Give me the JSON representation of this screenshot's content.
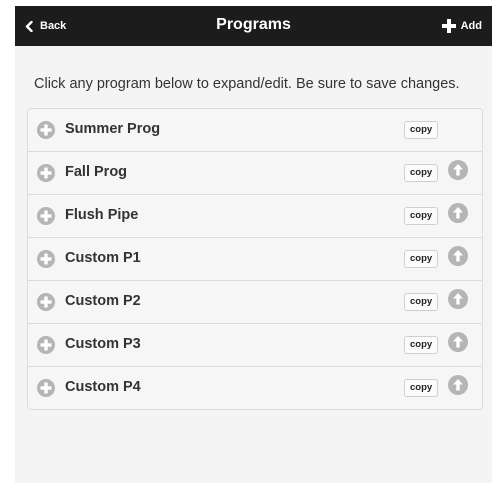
{
  "header": {
    "back_label": "Back",
    "title": "Programs",
    "add_label": "Add"
  },
  "instructions": "Click any program below to expand/edit. Be sure to save changes.",
  "programs": [
    {
      "name": "Summer Prog",
      "copy_label": "copy",
      "has_move_up": false
    },
    {
      "name": "Fall Prog",
      "copy_label": "copy",
      "has_move_up": true
    },
    {
      "name": "Flush Pipe",
      "copy_label": "copy",
      "has_move_up": true
    },
    {
      "name": "Custom P1",
      "copy_label": "copy",
      "has_move_up": true
    },
    {
      "name": "Custom P2",
      "copy_label": "copy",
      "has_move_up": true
    },
    {
      "name": "Custom P3",
      "copy_label": "copy",
      "has_move_up": true
    },
    {
      "name": "Custom P4",
      "copy_label": "copy",
      "has_move_up": true
    }
  ],
  "icons": {
    "back": "chevron-left-icon",
    "add": "plus-icon",
    "expand": "plus-circle-icon",
    "move_up": "arrow-up-circle-icon"
  },
  "colors": {
    "header_bg": "#1c1c1c",
    "page_bg": "#f4f4f4",
    "icon_grey": "#b5b5b5"
  }
}
